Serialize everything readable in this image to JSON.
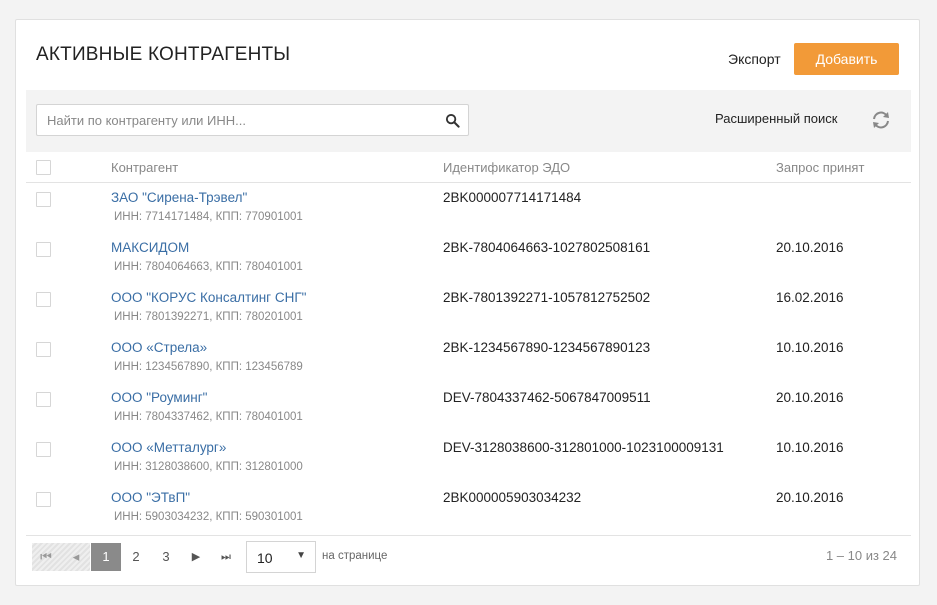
{
  "header": {
    "title": "АКТИВНЫЕ КОНТРАГЕНТЫ",
    "export_label": "Экспорт",
    "add_label": "Добавить"
  },
  "search": {
    "placeholder": "Найти по контрагенту или ИНН...",
    "value": "",
    "advanced_label": "Расширенный поиск"
  },
  "table": {
    "columns": [
      "Контрагент",
      "Идентификатор ЭДО",
      "Запрос принят"
    ],
    "rows": [
      {
        "name": "ЗАО \"Сирена-Трэвел\"",
        "details": "ИНН: 7714171484, КПП: 770901001",
        "edo": "2BK000007714171484",
        "date": ""
      },
      {
        "name": "МАКСИДОМ",
        "details": "ИНН: 7804064663, КПП: 780401001",
        "edo": "2BK-7804064663-1027802508161",
        "date": "20.10.2016"
      },
      {
        "name": "ООО \"КОРУС Консалтинг СНГ\"",
        "details": "ИНН: 7801392271, КПП: 780201001",
        "edo": "2BK-7801392271-1057812752502",
        "date": "16.02.2016"
      },
      {
        "name": "ООО «Стрела»",
        "details": "ИНН: 1234567890, КПП: 123456789",
        "edo": "2BK-1234567890-1234567890123",
        "date": "10.10.2016"
      },
      {
        "name": "ООО \"Роуминг\"",
        "details": "ИНН: 7804337462, КПП: 780401001",
        "edo": "DEV-7804337462-5067847009511",
        "date": "20.10.2016"
      },
      {
        "name": "ООО «Метталург»",
        "details": "ИНН: 3128038600, КПП: 312801000",
        "edo": "DEV-3128038600-312801000-1023100009131",
        "date": "10.10.2016"
      },
      {
        "name": "ООО \"ЭТвП\"",
        "details": "ИНН: 5903034232, КПП: 590301001",
        "edo": "2BK000005903034232",
        "date": "20.10.2016"
      }
    ]
  },
  "pagination": {
    "pages": [
      "1",
      "2",
      "3"
    ],
    "current": "1",
    "per_page": "10",
    "per_page_label": "на странице",
    "range": "1 – 10 из 24"
  },
  "icons": {
    "search": "search-icon",
    "refresh": "refresh-icon",
    "first": "first-page-icon",
    "prev": "prev-page-icon",
    "next": "next-page-icon",
    "last": "last-page-icon"
  },
  "colors": {
    "accent": "#f29a38",
    "link": "#3a6ea5",
    "current_page": "#8a8a8a"
  }
}
